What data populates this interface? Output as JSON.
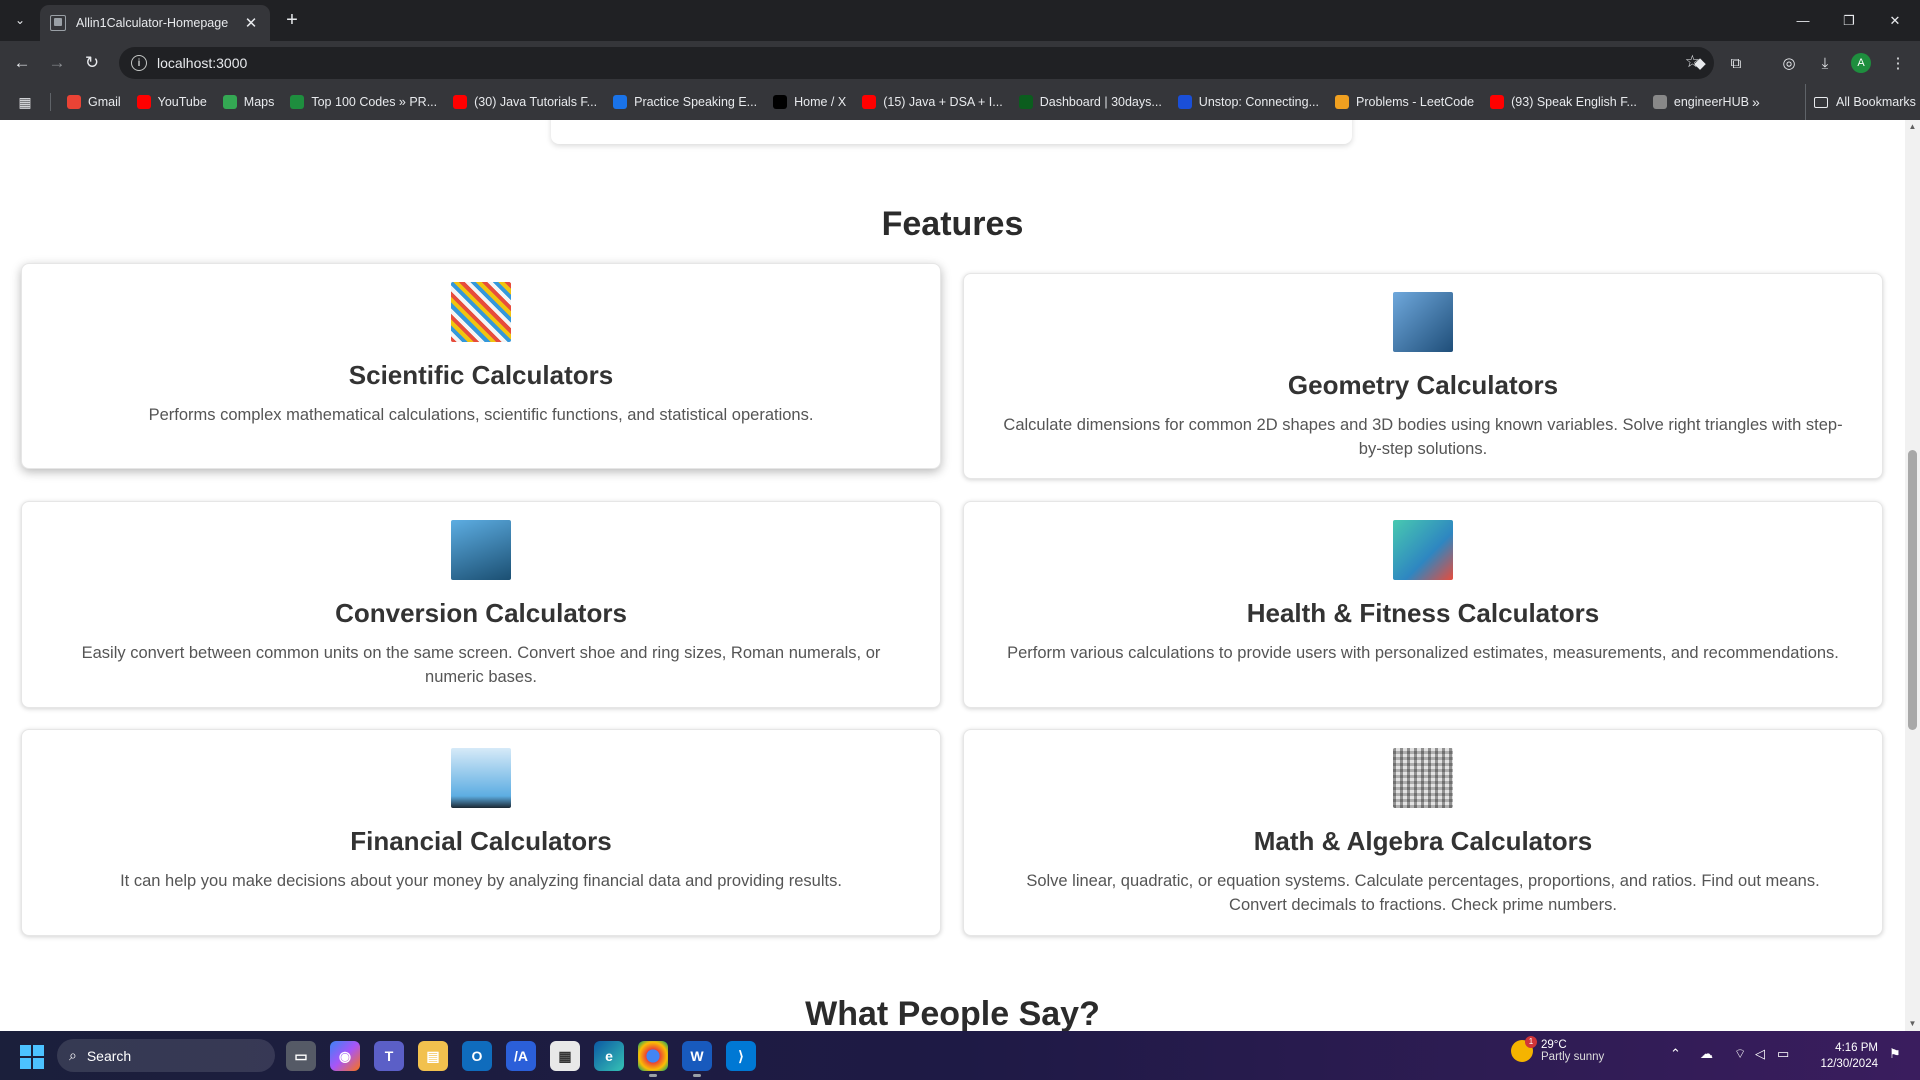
{
  "browser": {
    "tab_title": "Allin1Calculator-Homepage",
    "url": "localhost:3000",
    "avatar_letter": "A",
    "bookmarks": [
      {
        "label": "Gmail",
        "icon": "gmail-icon",
        "color": "#ea4335"
      },
      {
        "label": "YouTube",
        "icon": "youtube-icon",
        "color": "#ff0000"
      },
      {
        "label": "Maps",
        "icon": "maps-icon",
        "color": "#34a853"
      },
      {
        "label": "Top 100 Codes » PR...",
        "icon": "code-icon",
        "color": "#1e8e3e"
      },
      {
        "label": "(30) Java Tutorials F...",
        "icon": "youtube-icon",
        "color": "#ff0000"
      },
      {
        "label": "Practice Speaking E...",
        "icon": "globe-icon",
        "color": "#1a73e8"
      },
      {
        "label": "Home / X",
        "icon": "x-icon",
        "color": "#000000"
      },
      {
        "label": "(15) Java + DSA + I...",
        "icon": "youtube-icon",
        "color": "#ff0000"
      },
      {
        "label": "Dashboard | 30days...",
        "icon": "dashboard-icon",
        "color": "#0b5d1e"
      },
      {
        "label": "Unstop: Connecting...",
        "icon": "unstop-icon",
        "color": "#1a4fd8"
      },
      {
        "label": "Problems - LeetCode",
        "icon": "leetcode-icon",
        "color": "#f0a020"
      },
      {
        "label": "(93) Speak English F...",
        "icon": "youtube-icon",
        "color": "#ff0000"
      },
      {
        "label": "engineerHUB",
        "icon": "hub-icon",
        "color": "#888888"
      }
    ],
    "all_bookmarks_label": "All Bookmarks"
  },
  "page": {
    "features_title": "Features",
    "cards": [
      {
        "title": "Scientific Calculators",
        "desc": "Performs complex mathematical calculations, scientific functions, and statistical operations.",
        "image": "scientific-calculators-image"
      },
      {
        "title": "Geometry Calculators",
        "desc": "Calculate dimensions for common 2D shapes and 3D bodies using known variables. Solve right triangles with step-by-step solutions.",
        "image": "geometry-calculators-image"
      },
      {
        "title": "Conversion Calculators",
        "desc": "Easily convert between common units on the same screen. Convert shoe and ring sizes, Roman numerals, or numeric bases.",
        "image": "conversion-calculators-image"
      },
      {
        "title": "Health & Fitness Calculators",
        "desc": "Perform various calculations to provide users with personalized estimates, measurements, and recommendations.",
        "image": "health-fitness-calculators-image"
      },
      {
        "title": "Financial Calculators",
        "desc": "It can help you make decisions about your money by analyzing financial data and providing results.",
        "image": "financial-calculators-image"
      },
      {
        "title": "Math & Algebra Calculators",
        "desc": "Solve linear, quadratic, or equation systems. Calculate percentages, proportions, and ratios. Find out means. Convert decimals to fractions. Check prime numbers.",
        "image": "math-algebra-calculators-image"
      }
    ],
    "testimonials_title": "What People Say?"
  },
  "taskbar": {
    "search_placeholder": "Search",
    "weather_temp": "29°C",
    "weather_desc": "Partly sunny",
    "weather_badge": "1",
    "time": "4:16 PM",
    "date": "12/30/2024"
  }
}
